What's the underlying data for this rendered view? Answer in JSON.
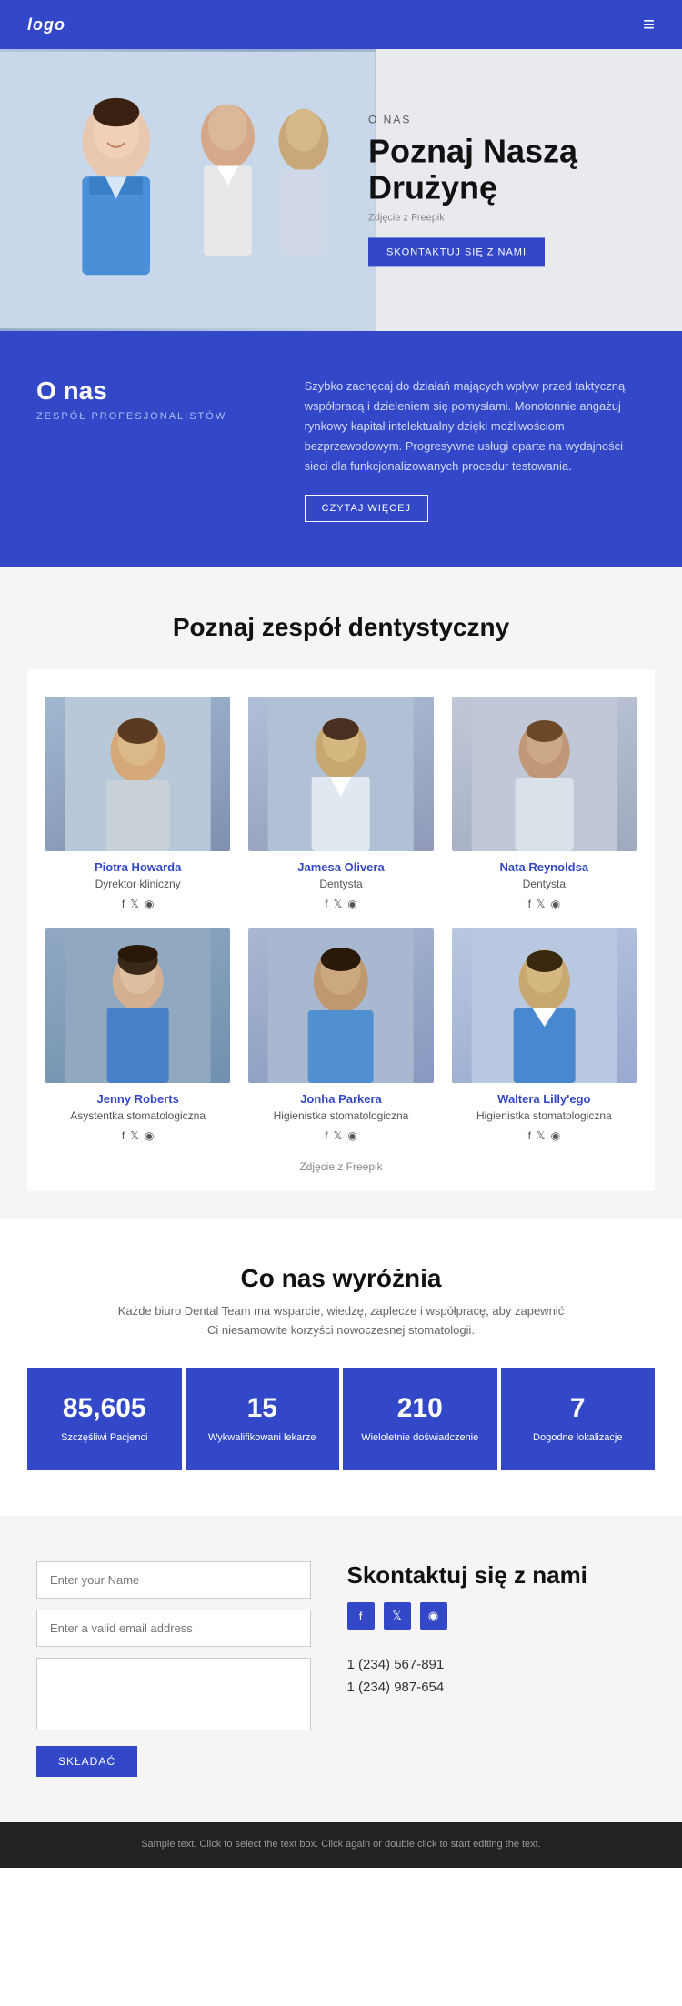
{
  "nav": {
    "logo": "logo",
    "menu_icon": "≡"
  },
  "hero": {
    "label": "O NAS",
    "title": "Poznaj Naszą Drużynę",
    "sub_label": "Zdjęcie z Freepik",
    "button": "SKONTAKTUJ SIĘ Z NAMI"
  },
  "about": {
    "title": "O nas",
    "subtitle": "ZESPÓŁ PROFESJONALISTÓW",
    "body": "Szybko zachęcaj do działań mających wpływ przed taktyczną współpracą i dzieleniem się pomysłami. Monotonnie angażuj rynkowy kapitał intelektualny dzięki możliwościom bezprzewodowym. Progresywne usługi oparte na wydajności sieci dla funkcjonalizowanych procedur testowania.",
    "button": "CZYTAJ WIĘCEJ"
  },
  "team": {
    "title": "Poznaj zespół dentystyczny",
    "members": [
      {
        "name": "Piotra Howarda",
        "role": "Dyrektor kliniczny"
      },
      {
        "name": "Jamesa Olivera",
        "role": "Dentysta"
      },
      {
        "name": "Nata Reynoldsa",
        "role": "Dentysta"
      },
      {
        "name": "Jenny Roberts",
        "role": "Asystentka stomatologiczna"
      },
      {
        "name": "Jonha Parkera",
        "role": "Higienistka stomatologiczna"
      },
      {
        "name": "Waltera Lilly'ego",
        "role": "Higienistka stomatologiczna"
      }
    ],
    "freepik_label": "Zdjęcie z Freepik",
    "freepik_link": "Freepik"
  },
  "social": {
    "icons": [
      "f",
      "𝕏",
      "◉"
    ]
  },
  "stats": {
    "title": "Co nas wyróżnia",
    "description": "Każde biuro Dental Team ma wsparcie, wiedzę, zaplecze i współpracę, aby zapewnić Ci niesamowite korzyści nowoczesnej stomatologii.",
    "items": [
      {
        "number": "85,605",
        "label": "Szczęśliwi Pacjenci"
      },
      {
        "number": "15",
        "label": "Wykwalifikowani lekarze"
      },
      {
        "number": "210",
        "label": "Wieloletnie doświadczenie"
      },
      {
        "number": "7",
        "label": "Dogodne lokalizacje"
      }
    ]
  },
  "contact": {
    "title": "Skontaktuj się z nami",
    "form": {
      "name_placeholder": "Enter your Name",
      "email_placeholder": "Enter a valid email address",
      "message_placeholder": "",
      "submit_label": "SKŁADAĆ"
    },
    "phones": [
      "1 (234) 567-891",
      "1 (234) 987-654"
    ],
    "social_icons": [
      "f",
      "𝕏",
      "◉"
    ]
  },
  "footer": {
    "text": "Sample text. Click to select the text box. Click again or double click to start editing the text."
  }
}
